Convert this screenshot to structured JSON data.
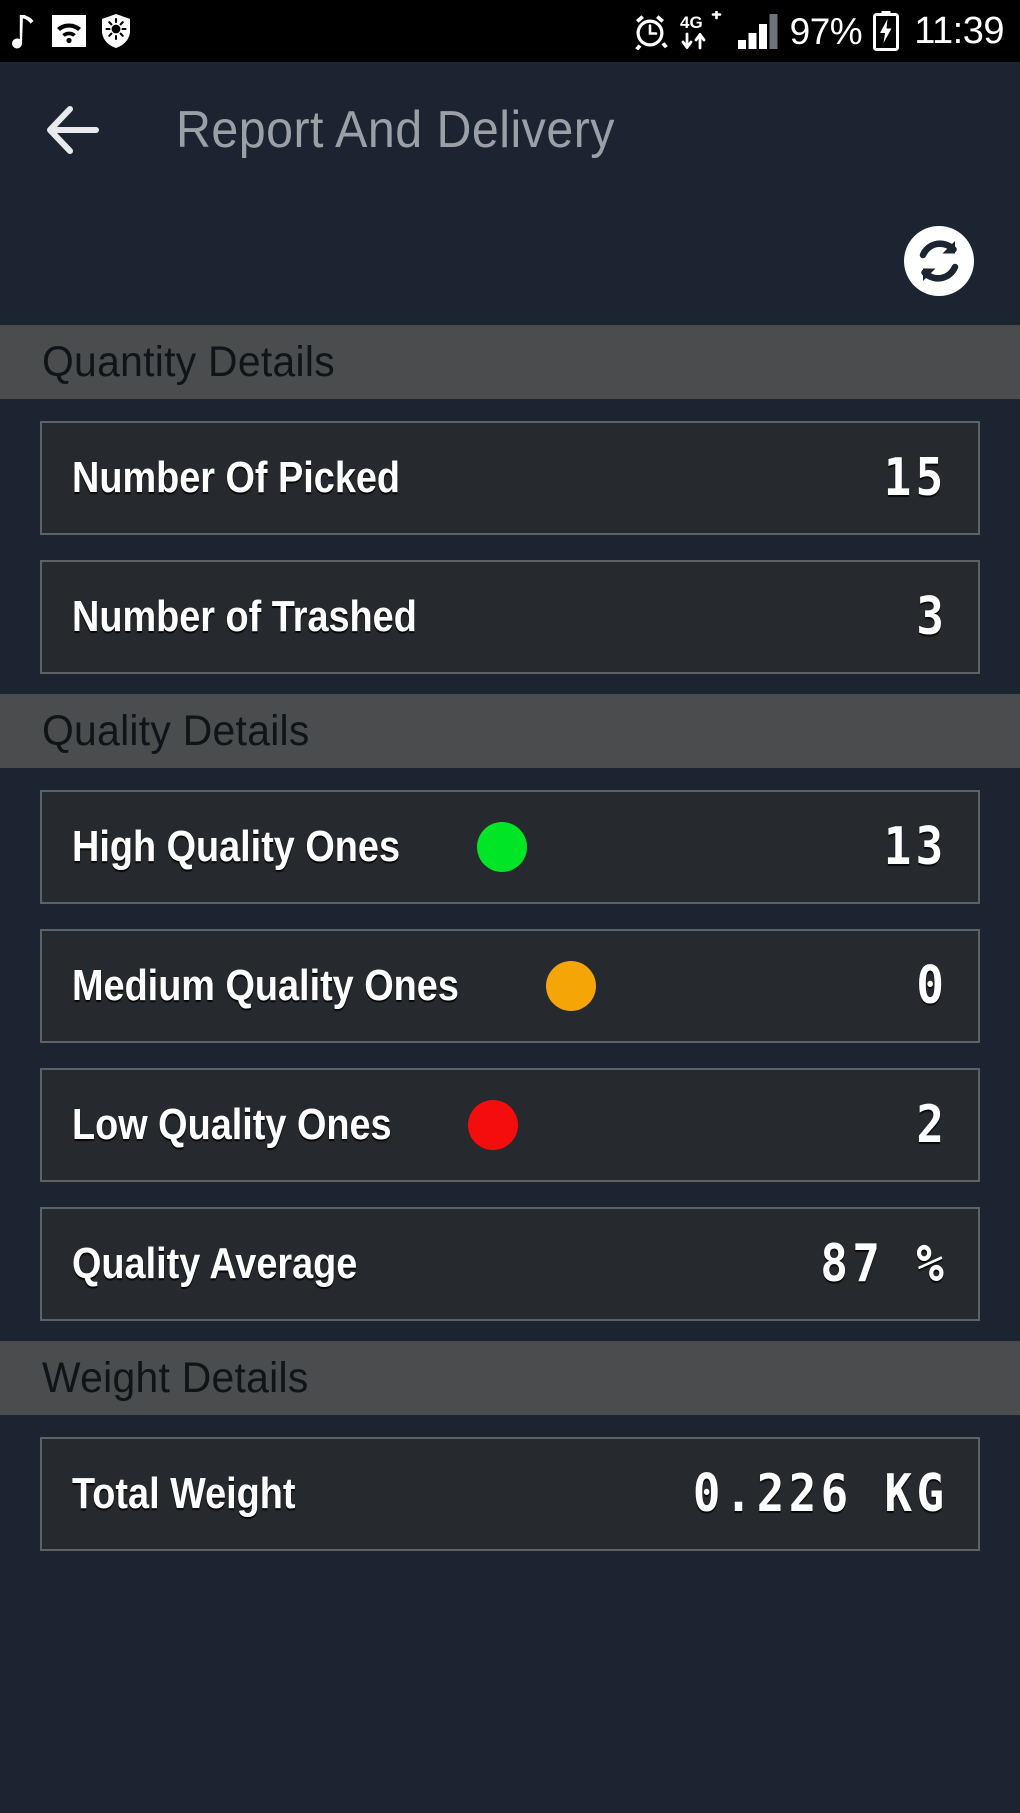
{
  "status_bar": {
    "left_icons": [
      "music-note-icon",
      "wifi-icon",
      "security-shield-icon"
    ],
    "right_icons": [
      "alarm-clock-icon",
      "mobile-data-4g-plus-icon",
      "signal-bars-icon",
      "battery-charging-icon"
    ],
    "network_label": "4G",
    "network_plus": "+",
    "battery_percent": "97%",
    "clock": "11:39"
  },
  "app_bar": {
    "back_icon": "arrow-left-icon",
    "title": "Report And Delivery"
  },
  "toolbar": {
    "sync_icon": "sync-refresh-icon"
  },
  "colors": {
    "page_background": "#1b2430",
    "section_header_background": "#4a4c4d",
    "card_background": "#26292d",
    "card_border": "#5f6265",
    "high_quality": "#00e526",
    "medium_quality": "#f5a506",
    "low_quality": "#f50d0d",
    "title_text": "#9aa0a6",
    "value_text": "#ffffff"
  },
  "sections": [
    {
      "title": "Quantity Details",
      "rows": [
        {
          "label": "Number Of Picked",
          "value": "15",
          "dot": null
        },
        {
          "label": "Number of Trashed",
          "value": "3",
          "dot": null
        }
      ]
    },
    {
      "title": "Quality Details",
      "rows": [
        {
          "label": "High Quality Ones",
          "value": "13",
          "dot": "#00e526"
        },
        {
          "label": "Medium Quality Ones",
          "value": "0",
          "dot": "#f5a506"
        },
        {
          "label": "Low Quality Ones",
          "value": "2",
          "dot": "#f50d0d"
        },
        {
          "label": "Quality Average",
          "value": "87 %",
          "dot": null
        }
      ]
    },
    {
      "title": "Weight Details",
      "rows": [
        {
          "label": "Total Weight",
          "value": "0.226 KG",
          "dot": null
        }
      ]
    }
  ]
}
